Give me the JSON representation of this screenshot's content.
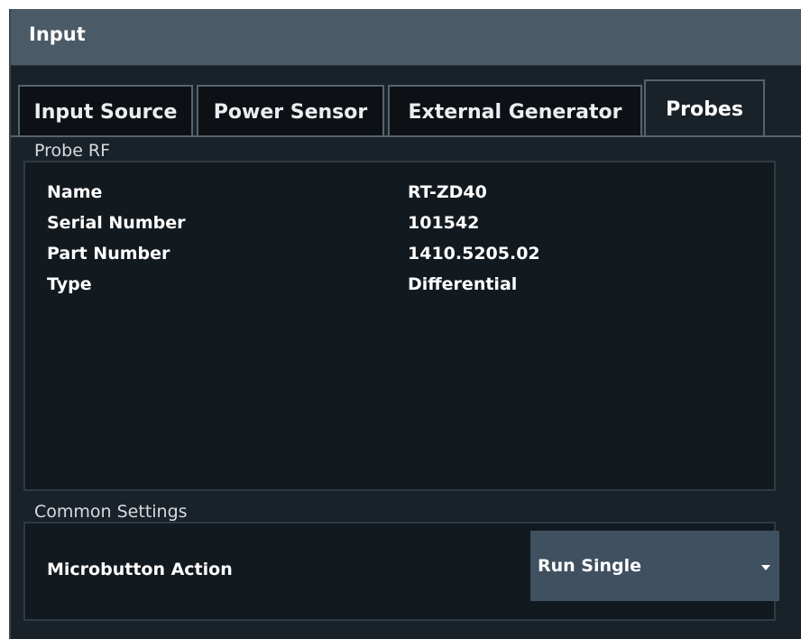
{
  "window": {
    "title": "Input"
  },
  "tabs": [
    {
      "label": "Input Source",
      "active": false
    },
    {
      "label": "Power Sensor",
      "active": false
    },
    {
      "label": "External Generator",
      "active": false
    },
    {
      "label": "Probes",
      "active": true
    }
  ],
  "probe_rf": {
    "group_label": "Probe RF",
    "rows": [
      {
        "key": "Name",
        "value": "RT-ZD40"
      },
      {
        "key": "Serial Number",
        "value": "101542"
      },
      {
        "key": "Part Number",
        "value": "1410.5205.02"
      },
      {
        "key": "Type",
        "value": "Differential"
      }
    ]
  },
  "common_settings": {
    "group_label": "Common Settings",
    "microbutton_label": "Microbutton Action",
    "microbutton_value": "Run Single"
  },
  "icons": {
    "dropdown": "chevron-down-icon"
  },
  "colors": {
    "titlebar": "#4a5a67",
    "background": "#1a2229",
    "tab_inactive": "#0d1116",
    "select": "#3f5060"
  }
}
